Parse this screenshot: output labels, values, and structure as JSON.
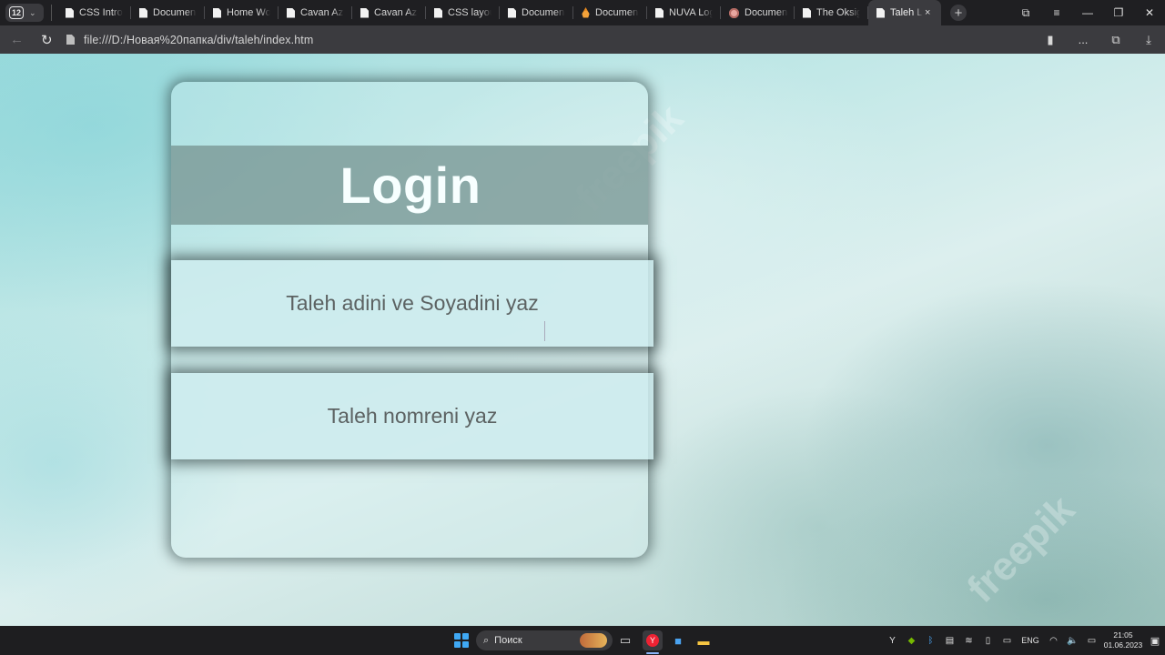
{
  "browser": {
    "tab_count": "12",
    "tabs": [
      {
        "label": "CSS Introd",
        "icon": "doc-icon"
      },
      {
        "label": "Documen",
        "icon": "doc-icon"
      },
      {
        "label": "Home Wo",
        "icon": "doc-icon"
      },
      {
        "label": "Cavan Az",
        "icon": "doc-icon"
      },
      {
        "label": "Cavan Az",
        "icon": "doc-icon"
      },
      {
        "label": "CSS layou",
        "icon": "doc-icon"
      },
      {
        "label": "Documen",
        "icon": "doc-icon"
      },
      {
        "label": "Documen",
        "icon": "drop-icon"
      },
      {
        "label": "NUVA Log",
        "icon": "doc-icon"
      },
      {
        "label": "Documen",
        "icon": "round-icon"
      },
      {
        "label": "The Oksig",
        "icon": "doc-icon"
      },
      {
        "label": "Taleh Lo",
        "icon": "doc-icon",
        "active": true
      }
    ],
    "close_glyph": "×",
    "new_tab_glyph": "+",
    "url": "file:///D:/Новая%20папка/div/taleh/index.htm",
    "more_glyph": "..."
  },
  "page": {
    "title": "Login",
    "name_placeholder": "Taleh adini ve Soyadini yaz",
    "phone_placeholder": "Taleh nomreni yaz",
    "watermarks": [
      "freepik",
      "freepik"
    ]
  },
  "taskbar": {
    "search_label": "Поиск",
    "lang": "ENG",
    "time": "21:05",
    "date": "01.06.2023"
  },
  "colors": {
    "accent": "#3fa9f5",
    "title_band": "#7a9693",
    "title_text": "#f7ffff"
  }
}
